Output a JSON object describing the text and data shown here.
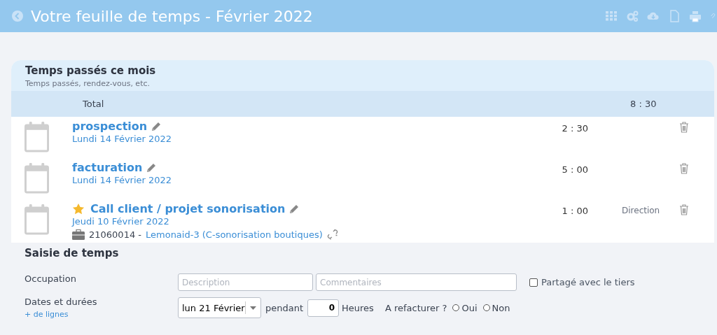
{
  "header": {
    "title": "Votre feuille de temps - Février 2022"
  },
  "card": {
    "title": "Temps passés ce mois",
    "subtitle": "Temps passés, rendez-vous, etc.",
    "total_label": "Total",
    "total_value": "8 : 30"
  },
  "entries": [
    {
      "title": "prospection",
      "starred": false,
      "date": "Lundi 14 Février 2022",
      "duration": "2 : 30"
    },
    {
      "title": "facturation",
      "starred": false,
      "date": "Lundi 14 Février 2022",
      "duration": "5 : 00"
    },
    {
      "title": "Call client / projet sonorisation",
      "starred": true,
      "date": "Jeudi 10 Février 2022",
      "duration": "1 : 00",
      "category": "Direction",
      "project": {
        "code": "21060014 -",
        "link": "Lemonaid-3 (C-sonorisation boutiques)"
      }
    }
  ],
  "form": {
    "title": "Saisie de temps",
    "occupation_label": "Occupation",
    "description": {
      "placeholder": "Description"
    },
    "comments": {
      "placeholder": "Commentaires"
    },
    "shared": {
      "label": "Partagé avec le tiers",
      "checked": false
    },
    "dates_label": "Dates et durées",
    "more_lines": "+ de lignes",
    "date_value": "lun 21 Février",
    "during": "pendant",
    "hours_value": "0",
    "hours_unit": "Heures",
    "rebill_label": "A refacturer ?",
    "rebill_options": [
      {
        "label": "Oui",
        "selected": false
      },
      {
        "label": "Non",
        "selected": false
      }
    ]
  }
}
